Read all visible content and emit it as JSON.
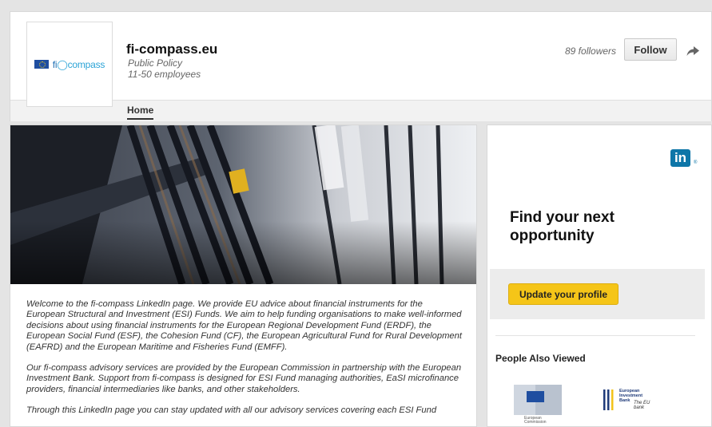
{
  "company": {
    "logo_text_fi": "fi",
    "logo_text_compass": "compass",
    "name": "fi-compass.eu",
    "industry": "Public Policy",
    "size": "11-50 employees"
  },
  "header": {
    "followers": "89 followers",
    "follow_label": "Follow",
    "tabs": [
      {
        "label": "Home"
      }
    ]
  },
  "about": {
    "paragraphs": [
      "Welcome to the fi-compass LinkedIn page. We provide EU advice about financial instruments for the European Structural and Investment (ESI) Funds. We aim to help funding organisations to make well-informed decisions about using financial instruments for the European Regional Development Fund (ERDF), the European Social Fund (ESF), the Cohesion Fund (CF), the European Agricultural Fund for Rural Development (EAFRD) and the European Maritime and Fisheries Fund (EMFF).",
      "Our fi-compass advisory services are provided by the European Commission in partnership with the European Investment Bank. Support from fi-compass is designed for ESI Fund managing authorities, EaSI microfinance providers, financial intermediaries like banks, and other stakeholders.",
      "Through this LinkedIn page you can stay updated with all our advisory services covering each ESI Fund"
    ]
  },
  "ad": {
    "brand": "in",
    "brand_reg": "®",
    "headline": "Find your next opportunity",
    "cta_label": "Update your profile"
  },
  "people_also_viewed": {
    "title": "People Also Viewed",
    "items": [
      {
        "caption_line1": "European",
        "caption_line2": "Commission"
      },
      {
        "text_line1": "European",
        "text_line2": "Investment",
        "text_line3": "Bank",
        "script": "The EU bank"
      }
    ]
  },
  "colors": {
    "linkedin_blue": "#0e76a8",
    "cta_yellow": "#f5c518",
    "eu_blue": "#1f4ea0"
  },
  "icons": [
    "share-arrow-icon",
    "eu-flag-icon"
  ]
}
